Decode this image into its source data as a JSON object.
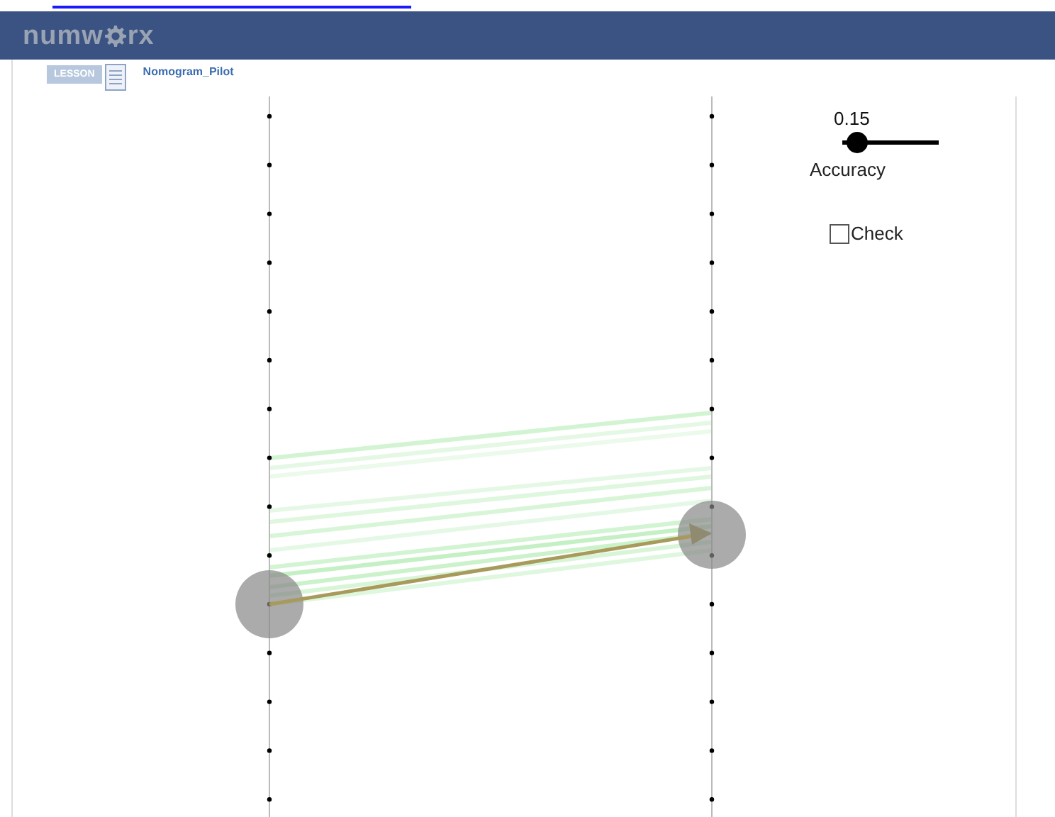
{
  "header": {
    "logo_start": "numw",
    "logo_end": "rx"
  },
  "lesson": {
    "badge": "LESSON",
    "title": "Nomogram_Pilot"
  },
  "slider": {
    "reading": "0.15",
    "label": "Accuracy",
    "level": 0.15
  },
  "check": {
    "label": "Check",
    "checked": false
  }
}
